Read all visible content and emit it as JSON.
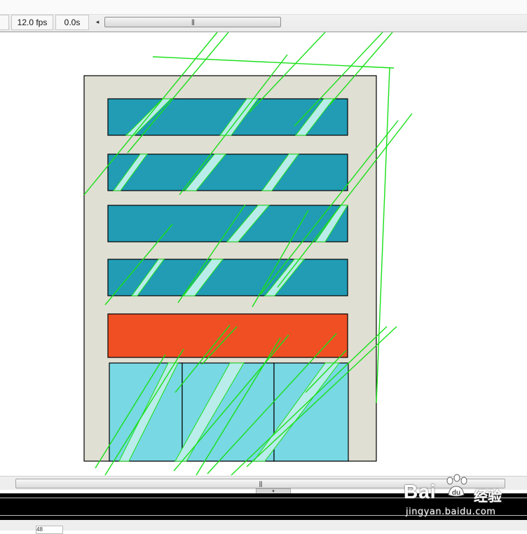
{
  "timeline": {
    "fps_label": "12.0 fps",
    "time_label": "0.0s",
    "scroll_left_glyph": "◂",
    "grip_glyph": "|||"
  },
  "stage": {
    "colors": {
      "building_bg": "#e0dfd3",
      "window_blue": "#219cb4",
      "orange_band": "#f04f24",
      "door_light_blue": "#78d8e4",
      "glass_streak": "#b9ecea",
      "outline_green": "#19e019",
      "border_black": "#000000"
    }
  },
  "bottom": {
    "grip_glyph": "|||",
    "handle_glyph": "▾",
    "field_value": "48"
  },
  "watermark": {
    "logo": "Bai",
    "paw_label": "du",
    "text": "经验",
    "url": "jingyan.baidu.com"
  }
}
